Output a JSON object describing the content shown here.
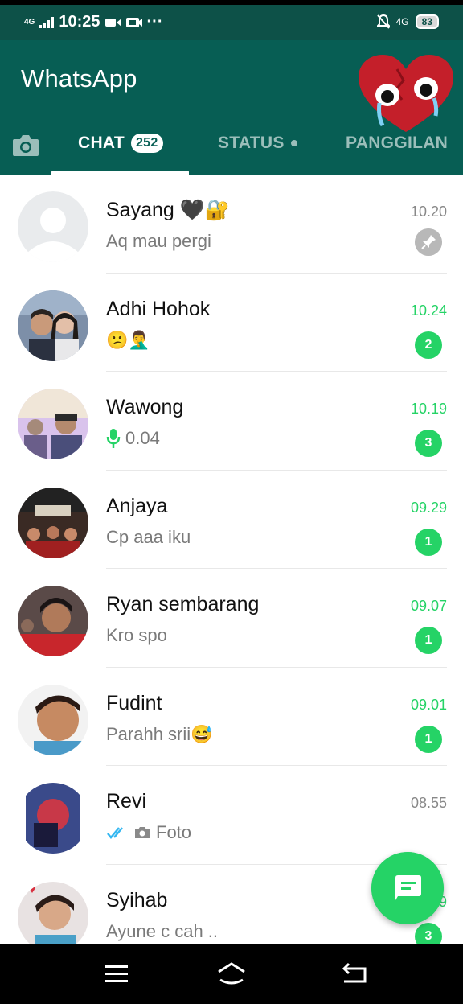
{
  "status_bar": {
    "signal_label": "4G",
    "time": "10:25",
    "more": "···",
    "net_label": "4G",
    "battery": "83"
  },
  "app": {
    "title": "WhatsApp"
  },
  "tabs": {
    "camera": "camera-icon",
    "chat": {
      "label": "CHAT",
      "badge": "252"
    },
    "status": {
      "label": "STATUS"
    },
    "calls": {
      "label": "PANGGILAN"
    }
  },
  "colors": {
    "header": "#075e54",
    "status_bar": "#0d5148",
    "accent": "#25d366",
    "tick_blue": "#34b7f1"
  },
  "chats": [
    {
      "name": "Sayang 🖤🔐",
      "message": "Aq mau pergi",
      "time": "10.20",
      "unread": "",
      "pinned": true
    },
    {
      "name": "Adhi Hohok",
      "message": "😕🤦‍♂️",
      "time": "10.24",
      "unread": "2"
    },
    {
      "name": "Wawong",
      "message": "0.04",
      "message_icon": "mic-icon",
      "time": "10.19",
      "unread": "3"
    },
    {
      "name": "Anjaya",
      "message": "Cp aaa iku",
      "time": "09.29",
      "unread": "1"
    },
    {
      "name": "Ryan sembarang",
      "message": "Kro spo",
      "time": "09.07",
      "unread": "1"
    },
    {
      "name": "Fudint",
      "message": "Parahh srii😅",
      "time": "09.01",
      "unread": "1"
    },
    {
      "name": "Revi",
      "message": "Foto",
      "message_icon": "double-tick-camera-icon",
      "time": "08.55",
      "unread": ""
    },
    {
      "name": "Syihab",
      "message": "Ayune c cah ..",
      "time": "08.49",
      "unread": "3"
    }
  ],
  "fab": {
    "icon": "new-chat-icon"
  },
  "nav": {
    "icons": [
      "menu-icon",
      "home-icon",
      "back-icon"
    ]
  }
}
